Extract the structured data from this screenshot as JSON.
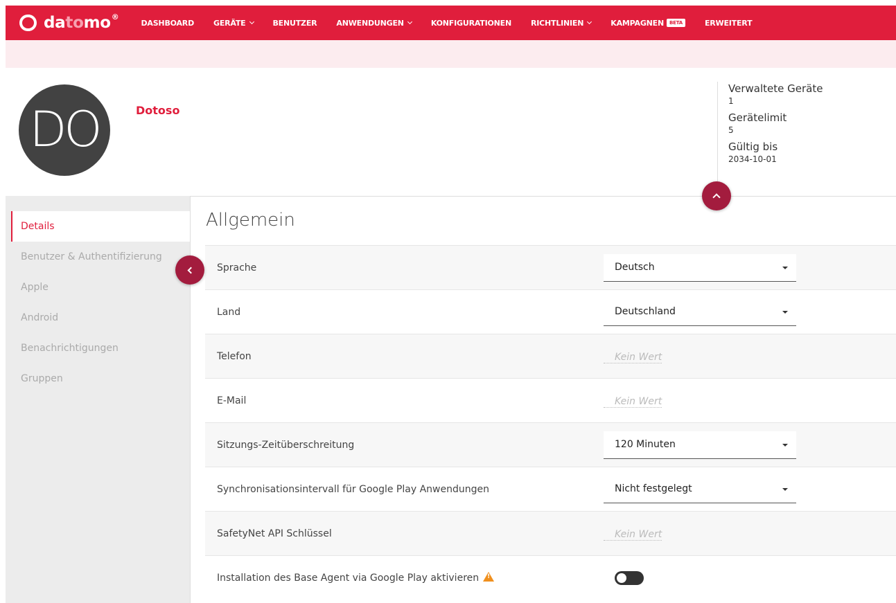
{
  "brand": {
    "part1": "da",
    "part2": "to",
    "part3": "mo",
    "reg": "®"
  },
  "nav": [
    {
      "label": "DASHBOARD",
      "dropdown": false
    },
    {
      "label": "GERÄTE",
      "dropdown": true
    },
    {
      "label": "BENUTZER",
      "dropdown": false
    },
    {
      "label": "ANWENDUNGEN",
      "dropdown": true
    },
    {
      "label": "KONFIGURATIONEN",
      "dropdown": false
    },
    {
      "label": "RICHTLINIEN",
      "dropdown": true
    },
    {
      "label": "KAMPAGNEN",
      "dropdown": false,
      "badge": "BETA"
    },
    {
      "label": "ERWEITERT",
      "dropdown": false
    }
  ],
  "header": {
    "avatar_initials": "DO",
    "company": "Dotoso",
    "stats": [
      {
        "label": "Verwaltete Geräte",
        "value": "1"
      },
      {
        "label": "Gerätelimit",
        "value": "5"
      },
      {
        "label": "Gültig bis",
        "value": "2034-10-01"
      }
    ]
  },
  "sidebar": {
    "items": [
      {
        "label": "Details",
        "active": true
      },
      {
        "label": "Benutzer & Authentifizierung",
        "active": false
      },
      {
        "label": "Apple",
        "active": false
      },
      {
        "label": "Android",
        "active": false
      },
      {
        "label": "Benachrichtigungen",
        "active": false
      },
      {
        "label": "Gruppen",
        "active": false
      }
    ]
  },
  "main": {
    "title": "Allgemein",
    "rows": [
      {
        "label": "Sprache",
        "type": "select",
        "value": "Deutsch"
      },
      {
        "label": "Land",
        "type": "select",
        "value": "Deutschland"
      },
      {
        "label": "Telefon",
        "type": "empty",
        "value": "Kein Wert"
      },
      {
        "label": "E-Mail",
        "type": "empty",
        "value": "Kein Wert"
      },
      {
        "label": "Sitzungs-Zeitüberschreitung",
        "type": "select",
        "value": "120 Minuten"
      },
      {
        "label": "Synchronisationsintervall für Google Play Anwendungen",
        "type": "select",
        "value": "Nicht festgelegt"
      },
      {
        "label": "SafetyNet API Schlüssel",
        "type": "empty",
        "value": "Kein Wert"
      },
      {
        "label": "Installation des Base Agent via Google Play aktivieren",
        "type": "toggle",
        "value": "off",
        "warning": true
      }
    ]
  },
  "colors": {
    "primary": "#e01e3c",
    "accent_dark": "#a31c3e"
  }
}
